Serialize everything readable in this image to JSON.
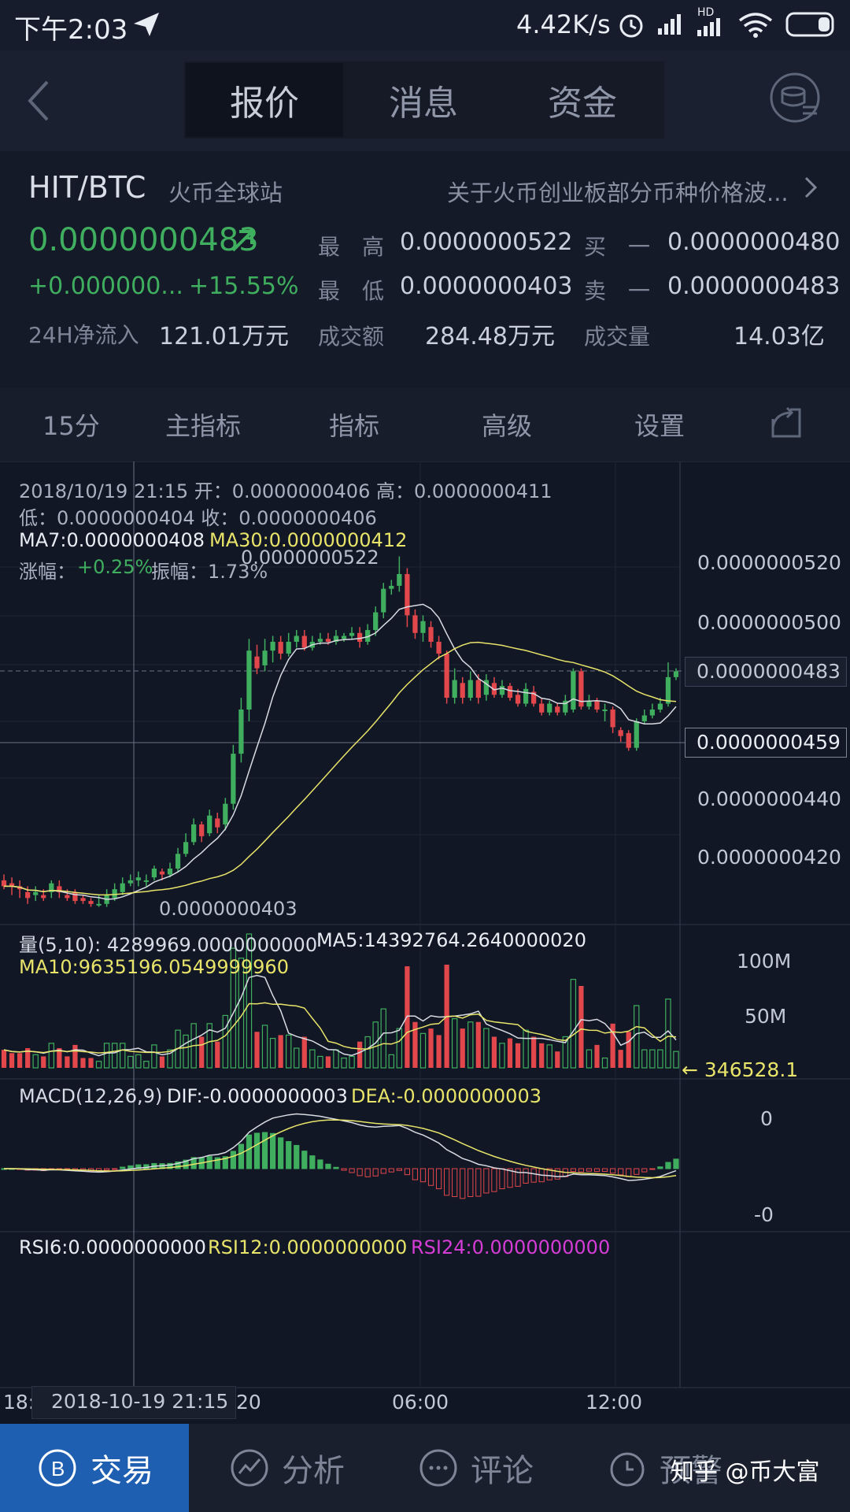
{
  "status": {
    "time": "下午2:03",
    "net_speed": "4.42K/s",
    "hd": "HD"
  },
  "nav": {
    "tabs": [
      "报价",
      "消息",
      "资金"
    ]
  },
  "ticker": {
    "pair": "HIT/BTC",
    "exchange": "火币全球站",
    "notice": "关于火币创业板部分币种价格波...",
    "price": "0.0000000483",
    "change_abs": "+0.000000...",
    "change_pct": "+15.55%",
    "high_label": "最　高",
    "high": "0.0000000522",
    "low_label": "最　低",
    "low": "0.0000000403",
    "buy1_label": "买　一",
    "buy1": "0.0000000480",
    "sell1_label": "卖　一",
    "sell1": "0.0000000483",
    "inflow_label": "24H净流入",
    "inflow": "121.01万元",
    "turnover_label": "成交额",
    "turnover": "284.48万元",
    "volume_label": "成交量",
    "volume": "14.03亿"
  },
  "toolbar": {
    "interval": "15分",
    "main_indicator": "主指标",
    "indicator": "指标",
    "advanced": "高级",
    "settings": "设置"
  },
  "info": {
    "line1": "2018/10/19 21:15 开：0.0000000406 高：0.0000000411",
    "line2": "低：0.0000000404 收：0.0000000406",
    "ma7": "MA7:0.0000000408",
    "ma30": "MA30:0.0000000412",
    "chg_label": "涨幅：",
    "chg": "+0.25%",
    "amp": "振幅：1.73%"
  },
  "price_axis": [
    "0.0000000520",
    "0.0000000500",
    "0.0000000483",
    "0.0000000459",
    "0.0000000440",
    "0.0000000420"
  ],
  "chart_labels": {
    "high": "0.0000000522",
    "low": "0.0000000403"
  },
  "volume_pane": {
    "header": "量(5,10): 4289969.0000000000",
    "ma5": "MA5:14392764.2640000020",
    "ma10": "MA10:9635196.0549999960",
    "axis": [
      "100M",
      "50M"
    ],
    "current": "346528.1"
  },
  "macd_pane": {
    "label": "MACD(12,26,9)",
    "dif": "DIF:-0.0000000003",
    "dea": "DEA:-0.0000000003",
    "axis": [
      "0",
      "-0"
    ]
  },
  "rsi_pane": {
    "rsi6": "RSI6:0.0000000000",
    "rsi12": "RSI12:0.0000000000",
    "rsi24": "RSI24:0.0000000000"
  },
  "time_axis": {
    "left": "18:",
    "cursor": "2018-10-19 21:15",
    "mid_suffix": "20",
    "t1": "06:00",
    "t2": "12:00"
  },
  "bottom_nav": {
    "trade": "交易",
    "analysis": "分析",
    "comment": "评论",
    "alert": "预警"
  },
  "watermark": "知乎 @币大富",
  "colors": {
    "up": "#3fae5e",
    "down": "#e2474c",
    "ma_white": "#d8dbe2",
    "ma_yellow": "#e8e46a",
    "macd_magenta": "#d63cd6"
  },
  "chart_data": {
    "type": "candlestick",
    "interval": "15分",
    "candles": [
      {
        "o": 412,
        "c": 410,
        "h": 414,
        "l": 409
      },
      {
        "o": 411,
        "c": 410,
        "h": 413,
        "l": 407
      },
      {
        "o": 410,
        "c": 409,
        "h": 412,
        "l": 406
      },
      {
        "o": 408,
        "c": 406,
        "h": 410,
        "l": 404
      },
      {
        "o": 407,
        "c": 408,
        "h": 410,
        "l": 405
      },
      {
        "o": 407,
        "c": 406,
        "h": 409,
        "l": 405
      },
      {
        "o": 408,
        "c": 411,
        "h": 412,
        "l": 406
      },
      {
        "o": 410,
        "c": 408,
        "h": 412,
        "l": 406
      },
      {
        "o": 407,
        "c": 406,
        "h": 409,
        "l": 405
      },
      {
        "o": 408,
        "c": 405,
        "h": 409,
        "l": 404
      },
      {
        "o": 406,
        "c": 405,
        "h": 407,
        "l": 404
      },
      {
        "o": 405,
        "c": 404,
        "h": 406,
        "l": 403
      },
      {
        "o": 404,
        "c": 404,
        "h": 407,
        "l": 403
      },
      {
        "o": 404,
        "c": 407,
        "h": 409,
        "l": 403
      },
      {
        "o": 406,
        "c": 409,
        "h": 411,
        "l": 405
      },
      {
        "o": 408,
        "c": 411,
        "h": 413,
        "l": 407
      },
      {
        "o": 411,
        "c": 412,
        "h": 414,
        "l": 410
      },
      {
        "o": 412,
        "c": 413,
        "h": 415,
        "l": 410
      },
      {
        "o": 412,
        "c": 412,
        "h": 414,
        "l": 410
      },
      {
        "o": 413,
        "c": 416,
        "h": 417,
        "l": 412
      },
      {
        "o": 415,
        "c": 414,
        "h": 416,
        "l": 412
      },
      {
        "o": 414,
        "c": 416,
        "h": 418,
        "l": 413
      },
      {
        "o": 416,
        "c": 421,
        "h": 423,
        "l": 415
      },
      {
        "o": 421,
        "c": 425,
        "h": 428,
        "l": 420
      },
      {
        "o": 425,
        "c": 431,
        "h": 433,
        "l": 424
      },
      {
        "o": 431,
        "c": 427,
        "h": 432,
        "l": 425
      },
      {
        "o": 428,
        "c": 434,
        "h": 436,
        "l": 427
      },
      {
        "o": 433,
        "c": 430,
        "h": 435,
        "l": 428
      },
      {
        "o": 431,
        "c": 438,
        "h": 440,
        "l": 429
      },
      {
        "o": 438,
        "c": 455,
        "h": 458,
        "l": 436
      },
      {
        "o": 455,
        "c": 470,
        "h": 474,
        "l": 452
      },
      {
        "o": 470,
        "c": 490,
        "h": 494,
        "l": 466
      },
      {
        "o": 488,
        "c": 484,
        "h": 492,
        "l": 482
      },
      {
        "o": 485,
        "c": 490,
        "h": 494,
        "l": 483
      },
      {
        "o": 490,
        "c": 493,
        "h": 495,
        "l": 486
      },
      {
        "o": 493,
        "c": 489,
        "h": 495,
        "l": 487
      },
      {
        "o": 489,
        "c": 493,
        "h": 496,
        "l": 488
      },
      {
        "o": 493,
        "c": 495,
        "h": 497,
        "l": 491
      },
      {
        "o": 495,
        "c": 491,
        "h": 497,
        "l": 490
      },
      {
        "o": 491,
        "c": 493,
        "h": 495,
        "l": 490
      },
      {
        "o": 493,
        "c": 494,
        "h": 496,
        "l": 492
      },
      {
        "o": 494,
        "c": 493,
        "h": 496,
        "l": 492
      },
      {
        "o": 493,
        "c": 495,
        "h": 497,
        "l": 492
      },
      {
        "o": 494,
        "c": 495,
        "h": 496,
        "l": 493
      },
      {
        "o": 495,
        "c": 496,
        "h": 498,
        "l": 494
      },
      {
        "o": 496,
        "c": 493,
        "h": 498,
        "l": 491
      },
      {
        "o": 493,
        "c": 497,
        "h": 499,
        "l": 492
      },
      {
        "o": 497,
        "c": 503,
        "h": 505,
        "l": 495
      },
      {
        "o": 503,
        "c": 511,
        "h": 513,
        "l": 501
      },
      {
        "o": 511,
        "c": 512,
        "h": 514,
        "l": 509
      },
      {
        "o": 512,
        "c": 516,
        "h": 522,
        "l": 510
      },
      {
        "o": 516,
        "c": 502,
        "h": 518,
        "l": 498
      },
      {
        "o": 502,
        "c": 496,
        "h": 504,
        "l": 494
      },
      {
        "o": 496,
        "c": 500,
        "h": 502,
        "l": 493
      },
      {
        "o": 498,
        "c": 493,
        "h": 500,
        "l": 491
      },
      {
        "o": 493,
        "c": 489,
        "h": 495,
        "l": 487
      },
      {
        "o": 489,
        "c": 474,
        "h": 490,
        "l": 472
      },
      {
        "o": 474,
        "c": 480,
        "h": 484,
        "l": 472
      },
      {
        "o": 479,
        "c": 474,
        "h": 481,
        "l": 472
      },
      {
        "o": 474,
        "c": 480,
        "h": 483,
        "l": 473
      },
      {
        "o": 480,
        "c": 474,
        "h": 482,
        "l": 472
      },
      {
        "o": 475,
        "c": 480,
        "h": 482,
        "l": 473
      },
      {
        "o": 479,
        "c": 475,
        "h": 481,
        "l": 474
      },
      {
        "o": 475,
        "c": 478,
        "h": 480,
        "l": 474
      },
      {
        "o": 478,
        "c": 474,
        "h": 479,
        "l": 473
      },
      {
        "o": 475,
        "c": 472,
        "h": 477,
        "l": 471
      },
      {
        "o": 472,
        "c": 477,
        "h": 479,
        "l": 471
      },
      {
        "o": 476,
        "c": 472,
        "h": 478,
        "l": 471
      },
      {
        "o": 472,
        "c": 469,
        "h": 474,
        "l": 468
      },
      {
        "o": 469,
        "c": 472,
        "h": 473,
        "l": 468
      },
      {
        "o": 471,
        "c": 469,
        "h": 472,
        "l": 468
      },
      {
        "o": 469,
        "c": 473,
        "h": 475,
        "l": 468
      },
      {
        "o": 470,
        "c": 483,
        "h": 484,
        "l": 469
      },
      {
        "o": 483,
        "c": 471,
        "h": 484,
        "l": 470
      },
      {
        "o": 471,
        "c": 473,
        "h": 475,
        "l": 470
      },
      {
        "o": 473,
        "c": 470,
        "h": 474,
        "l": 469
      },
      {
        "o": 470,
        "c": 470,
        "h": 472,
        "l": 466
      },
      {
        "o": 470,
        "c": 464,
        "h": 471,
        "l": 462
      },
      {
        "o": 463,
        "c": 461,
        "h": 464,
        "l": 459
      },
      {
        "o": 462,
        "c": 457,
        "h": 463,
        "l": 456
      },
      {
        "o": 457,
        "c": 466,
        "h": 467,
        "l": 456
      },
      {
        "o": 466,
        "c": 468,
        "h": 470,
        "l": 465
      },
      {
        "o": 468,
        "c": 470,
        "h": 472,
        "l": 467
      },
      {
        "o": 470,
        "c": 472,
        "h": 474,
        "l": 469
      },
      {
        "o": 472,
        "c": 481,
        "h": 486,
        "l": 471
      },
      {
        "o": 481,
        "c": 483,
        "h": 484,
        "l": 480
      }
    ]
  }
}
